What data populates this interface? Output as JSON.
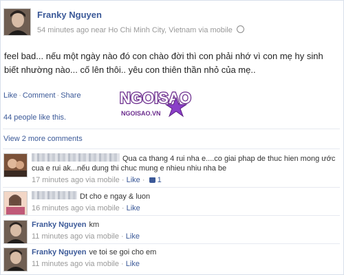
{
  "post": {
    "author": "Franky Nguyen",
    "meta": "54 minutes ago near Ho Chi Minh City, Vietnam via mobile",
    "status_text": "feel bad... nếu một ngày nào đó con chào đời thì con phải nhớ vì con mẹ hy sinh biết nhường nào... cố lên thôi.. yêu con thiên thần nhỏ của mẹ..",
    "actions": [
      "Like",
      "Comment",
      "Share"
    ],
    "likes_text": "44 people like this.",
    "view_more": "View 2 more comments",
    "watermark_text": "NGOISAO",
    "watermark_sub": "NGOISAO.VN"
  },
  "comments": [
    {
      "author_name": "",
      "text": "Qua ca thang 4 rui nha e....co giai phap de thuc hien mong ước cua e rui ak...nếu dung thi chuc mung e nhieu nhiu nha be",
      "time": "17 minutes ago via mobile",
      "like_label": "Like",
      "like_count": "1"
    },
    {
      "author_name": "",
      "text": "Dt cho e ngay & luon",
      "time": "16 minutes ago via mobile",
      "like_label": "Like"
    },
    {
      "author_name": "Franky Nguyen",
      "text": "km",
      "time": "11 minutes ago via mobile",
      "like_label": "Like"
    },
    {
      "author_name": "Franky Nguyen",
      "text": "ve toi se goi cho em",
      "time": "11 minutes ago via mobile",
      "like_label": "Like"
    }
  ],
  "colors": {
    "link": "#3b5998",
    "muted": "#999999",
    "watermark_purple": "#6a2b8c",
    "watermark_star": "#8a3fc8"
  }
}
